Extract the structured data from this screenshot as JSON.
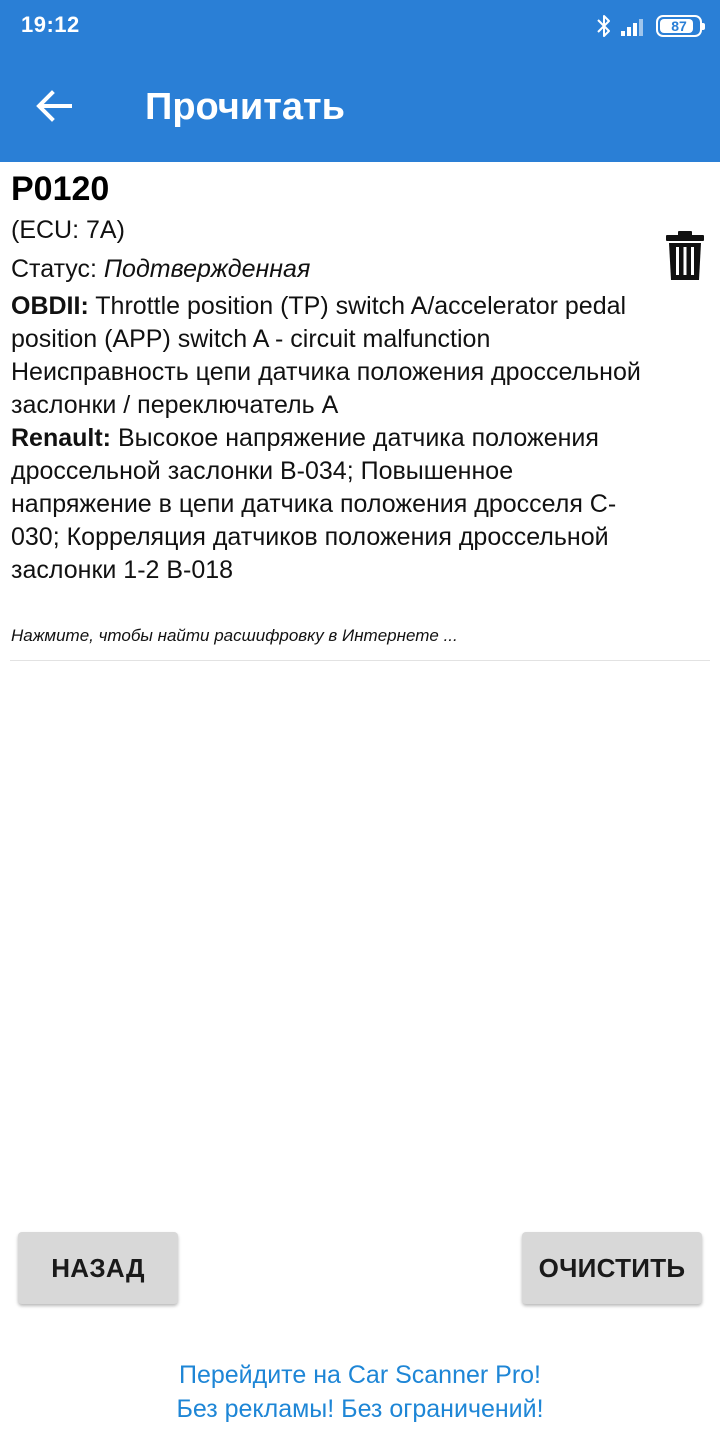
{
  "status_bar": {
    "time": "19:12",
    "battery_level": 87,
    "icons": [
      "bluetooth-icon",
      "signal-icon",
      "battery-icon"
    ]
  },
  "toolbar": {
    "title": "Прочитать",
    "back_icon": "arrow-left-icon"
  },
  "dtc": {
    "code": "P0120",
    "ecu": "(ECU: 7A)",
    "status_label": "Статус: ",
    "status_value": "Подтвержденная",
    "obd_label": "OBDII:",
    "obd_text": " Throttle position (TP) switch A/accelerator pedal position (APP) switch A - circuit malfunction",
    "obd_translation": "Неисправность цепи датчика положения дроссельной заслонки / переключатель А",
    "maker_label": "Renault:",
    "maker_text": " Высокое напряжение датчика положения дроссельной заслонки B-034; Повышенное напряжение в цепи датчика положения дросселя C-030; Корреляция датчиков положения дроссельной заслонки 1-2 B-018",
    "hint": "Нажмите, чтобы найти расшифровку в Интернете ...",
    "delete_icon": "trash-icon"
  },
  "buttons": {
    "back": "НАЗАД",
    "clear": "ОЧИСТИТЬ"
  },
  "promo": {
    "line1": "Перейдите на Car Scanner Pro!",
    "line2": "Без рекламы! Без ограничений!"
  },
  "colors": {
    "primary": "#2a7fd6",
    "promo_text": "#1e86d6",
    "button_bg": "#d8d8d8"
  }
}
